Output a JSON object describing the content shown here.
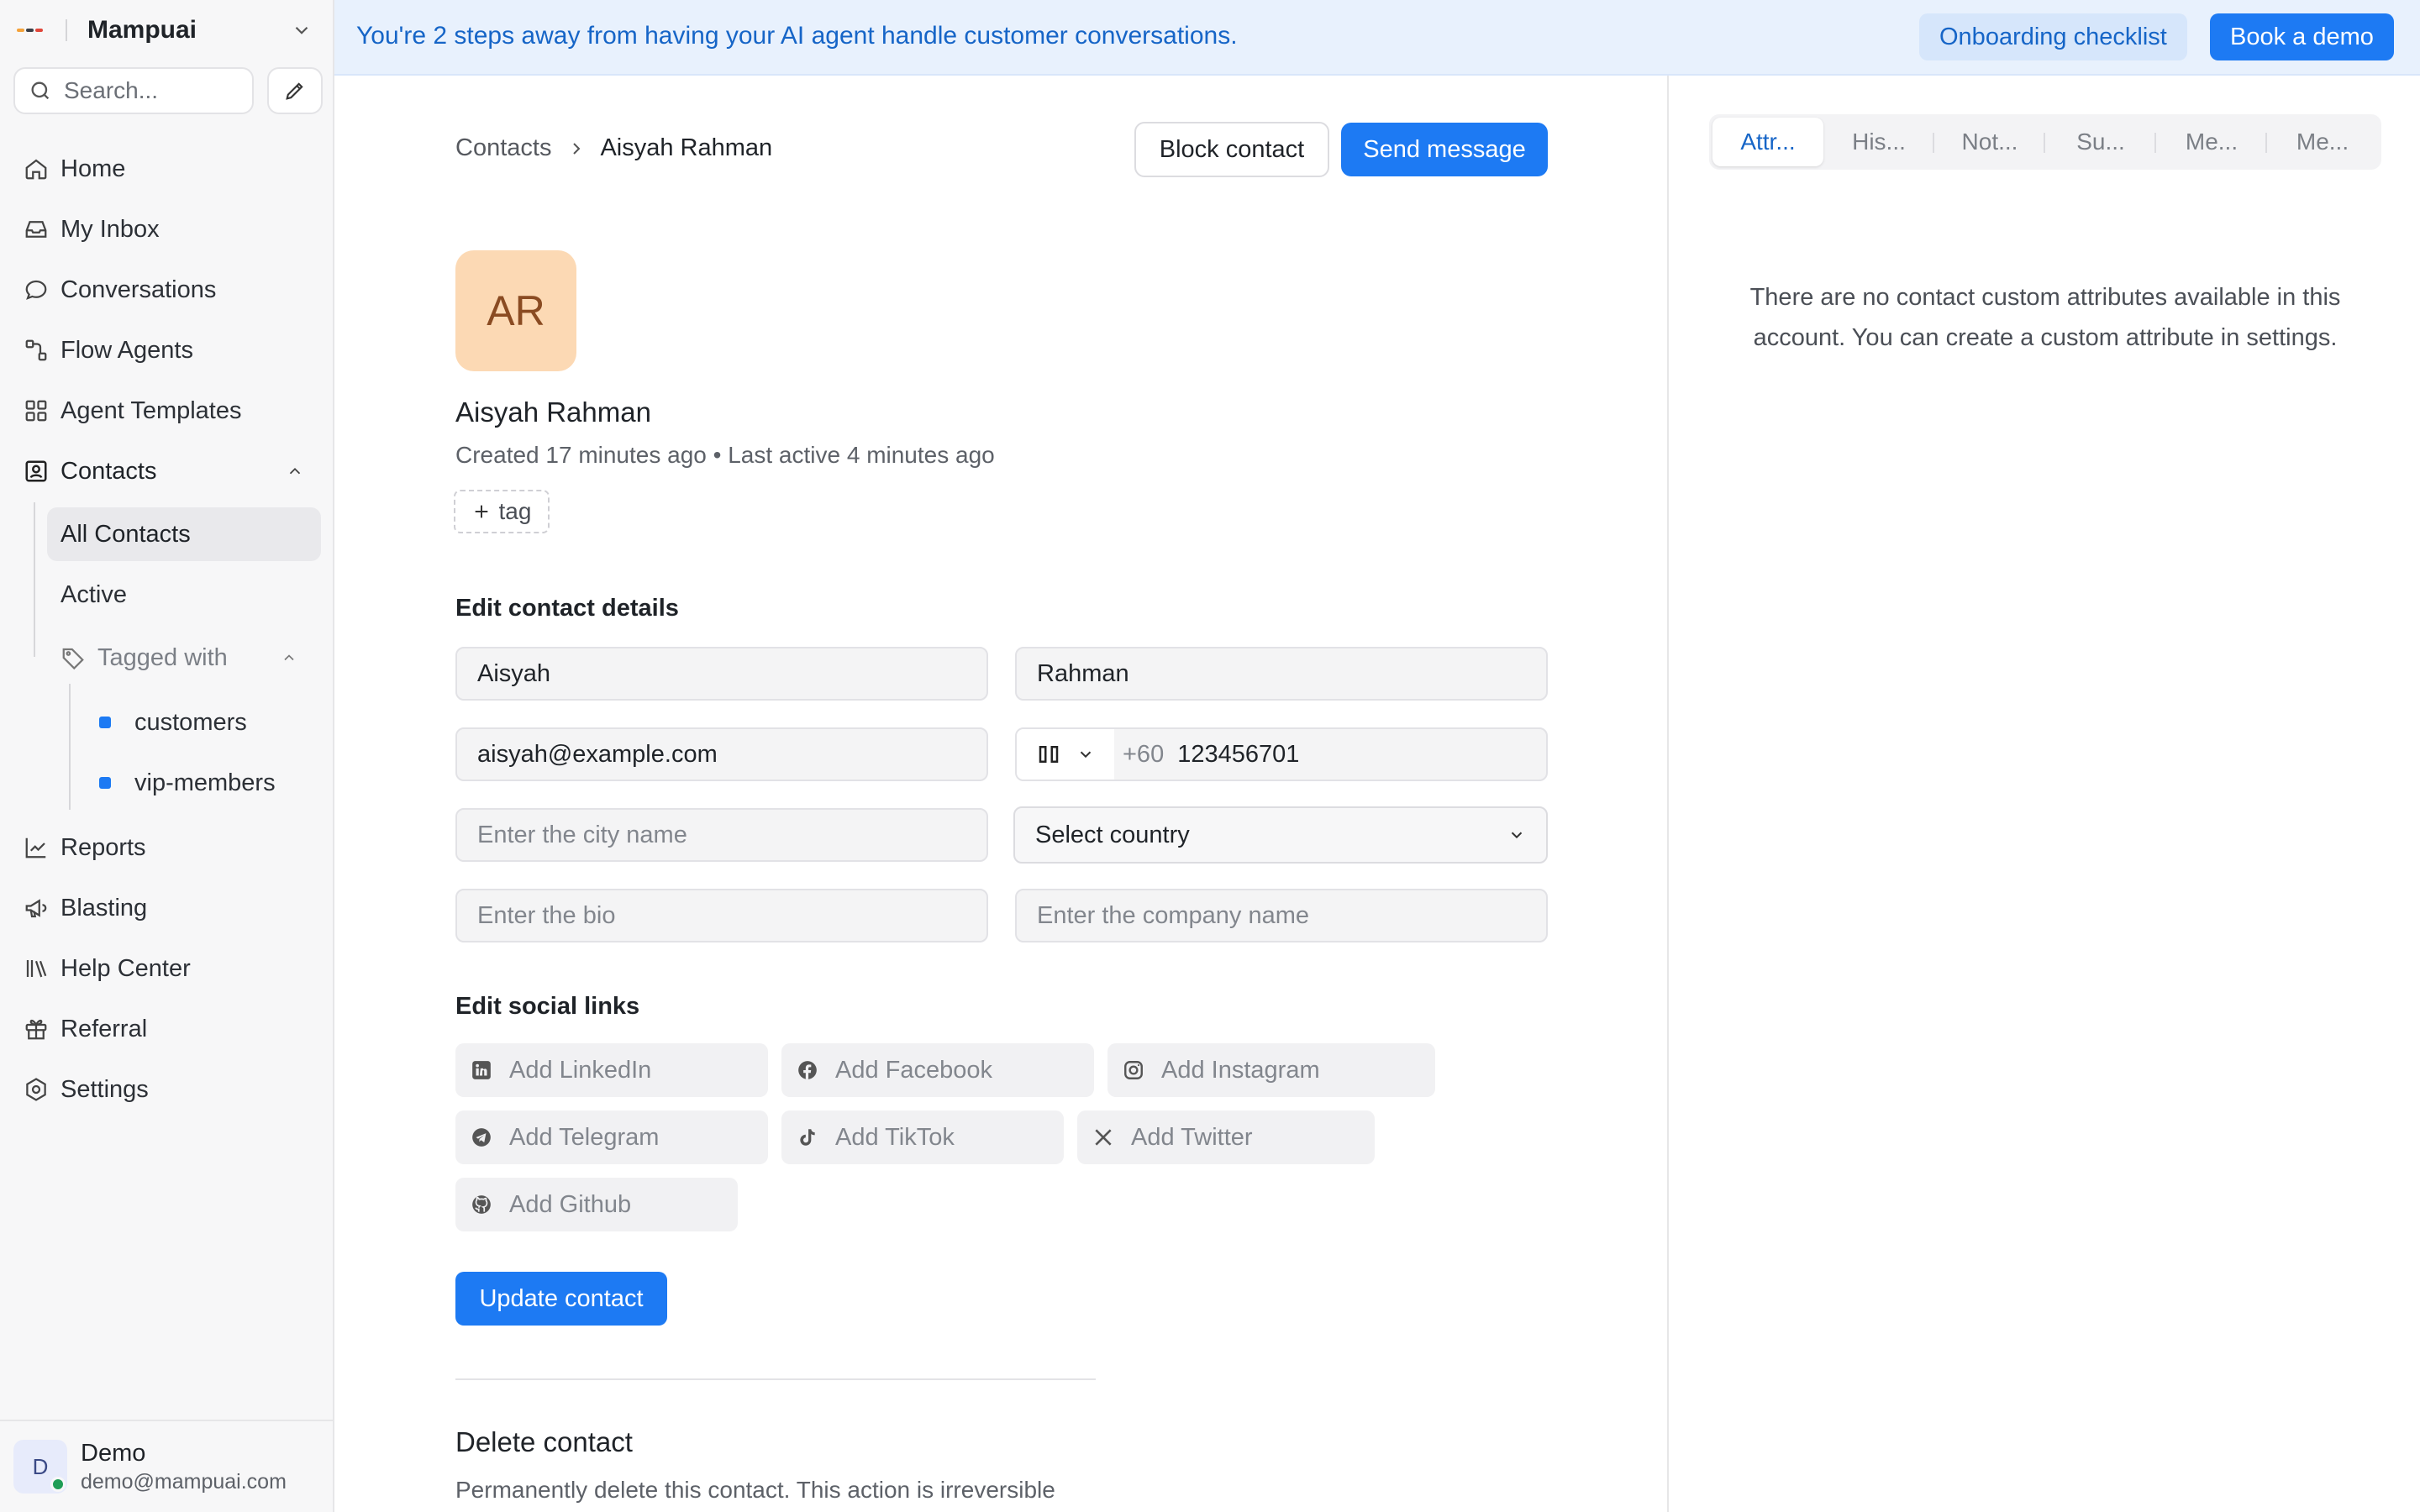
{
  "sidebar": {
    "workspace": "Mampuai",
    "search_placeholder": "Search...",
    "nav": {
      "home": "Home",
      "inbox": "My Inbox",
      "conversations": "Conversations",
      "flow_agents": "Flow Agents",
      "agent_templates": "Agent Templates",
      "contacts": "Contacts",
      "all_contacts": "All Contacts",
      "active": "Active",
      "tagged_with": "Tagged with",
      "tags": [
        "customers",
        "vip-members"
      ],
      "reports": "Reports",
      "blasting": "Blasting",
      "help_center": "Help Center",
      "referral": "Referral",
      "settings": "Settings"
    },
    "user": {
      "initial": "D",
      "name": "Demo",
      "email": "demo@mampuai.com"
    }
  },
  "banner": {
    "message": "You're 2 steps away from having your AI agent handle customer conversations.",
    "onboarding": "Onboarding checklist",
    "book_demo": "Book a demo"
  },
  "header": {
    "breadcrumb_root": "Contacts",
    "breadcrumb_current": "Aisyah Rahman",
    "block_contact": "Block contact",
    "send_message": "Send message"
  },
  "contact": {
    "initials": "AR",
    "name": "Aisyah Rahman",
    "meta": "Created 17 minutes ago • Last active 4 minutes ago",
    "add_tag": "tag"
  },
  "details": {
    "title": "Edit contact details",
    "first_name": "Aisyah",
    "last_name": "Rahman",
    "email": "aisyah@example.com",
    "phone_code": "+60",
    "phone_number": "123456701",
    "city_placeholder": "Enter the city name",
    "country": "Select country",
    "bio_placeholder": "Enter the bio",
    "company_placeholder": "Enter the company name"
  },
  "social": {
    "title": "Edit social links",
    "linkedin": "Add LinkedIn",
    "facebook": "Add Facebook",
    "instagram": "Add Instagram",
    "telegram": "Add Telegram",
    "tiktok": "Add TikTok",
    "twitter": "Add Twitter",
    "github": "Add Github"
  },
  "update_button": "Update contact",
  "delete": {
    "title": "Delete contact",
    "description": "Permanently delete this contact. This action is irreversible"
  },
  "right_pane": {
    "tabs": [
      "Attr...",
      "His...",
      "Not...",
      "Su...",
      "Me...",
      "Me..."
    ],
    "active_tab": 0,
    "empty_message": "There are no contact custom attributes available in this account. You can create a custom attribute in settings."
  },
  "colors": {
    "accent": "#1d7af3",
    "banner_bg": "#e8f1fd",
    "avatar_bg": "#fcd9b4"
  }
}
